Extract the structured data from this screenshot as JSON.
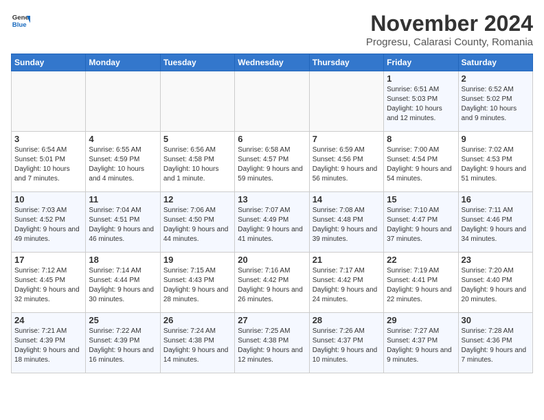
{
  "header": {
    "logo_general": "General",
    "logo_blue": "Blue",
    "month": "November 2024",
    "location": "Progresu, Calarasi County, Romania"
  },
  "days_of_week": [
    "Sunday",
    "Monday",
    "Tuesday",
    "Wednesday",
    "Thursday",
    "Friday",
    "Saturday"
  ],
  "weeks": [
    [
      {
        "day": "",
        "info": ""
      },
      {
        "day": "",
        "info": ""
      },
      {
        "day": "",
        "info": ""
      },
      {
        "day": "",
        "info": ""
      },
      {
        "day": "",
        "info": ""
      },
      {
        "day": "1",
        "info": "Sunrise: 6:51 AM\nSunset: 5:03 PM\nDaylight: 10 hours and 12 minutes."
      },
      {
        "day": "2",
        "info": "Sunrise: 6:52 AM\nSunset: 5:02 PM\nDaylight: 10 hours and 9 minutes."
      }
    ],
    [
      {
        "day": "3",
        "info": "Sunrise: 6:54 AM\nSunset: 5:01 PM\nDaylight: 10 hours and 7 minutes."
      },
      {
        "day": "4",
        "info": "Sunrise: 6:55 AM\nSunset: 4:59 PM\nDaylight: 10 hours and 4 minutes."
      },
      {
        "day": "5",
        "info": "Sunrise: 6:56 AM\nSunset: 4:58 PM\nDaylight: 10 hours and 1 minute."
      },
      {
        "day": "6",
        "info": "Sunrise: 6:58 AM\nSunset: 4:57 PM\nDaylight: 9 hours and 59 minutes."
      },
      {
        "day": "7",
        "info": "Sunrise: 6:59 AM\nSunset: 4:56 PM\nDaylight: 9 hours and 56 minutes."
      },
      {
        "day": "8",
        "info": "Sunrise: 7:00 AM\nSunset: 4:54 PM\nDaylight: 9 hours and 54 minutes."
      },
      {
        "day": "9",
        "info": "Sunrise: 7:02 AM\nSunset: 4:53 PM\nDaylight: 9 hours and 51 minutes."
      }
    ],
    [
      {
        "day": "10",
        "info": "Sunrise: 7:03 AM\nSunset: 4:52 PM\nDaylight: 9 hours and 49 minutes."
      },
      {
        "day": "11",
        "info": "Sunrise: 7:04 AM\nSunset: 4:51 PM\nDaylight: 9 hours and 46 minutes."
      },
      {
        "day": "12",
        "info": "Sunrise: 7:06 AM\nSunset: 4:50 PM\nDaylight: 9 hours and 44 minutes."
      },
      {
        "day": "13",
        "info": "Sunrise: 7:07 AM\nSunset: 4:49 PM\nDaylight: 9 hours and 41 minutes."
      },
      {
        "day": "14",
        "info": "Sunrise: 7:08 AM\nSunset: 4:48 PM\nDaylight: 9 hours and 39 minutes."
      },
      {
        "day": "15",
        "info": "Sunrise: 7:10 AM\nSunset: 4:47 PM\nDaylight: 9 hours and 37 minutes."
      },
      {
        "day": "16",
        "info": "Sunrise: 7:11 AM\nSunset: 4:46 PM\nDaylight: 9 hours and 34 minutes."
      }
    ],
    [
      {
        "day": "17",
        "info": "Sunrise: 7:12 AM\nSunset: 4:45 PM\nDaylight: 9 hours and 32 minutes."
      },
      {
        "day": "18",
        "info": "Sunrise: 7:14 AM\nSunset: 4:44 PM\nDaylight: 9 hours and 30 minutes."
      },
      {
        "day": "19",
        "info": "Sunrise: 7:15 AM\nSunset: 4:43 PM\nDaylight: 9 hours and 28 minutes."
      },
      {
        "day": "20",
        "info": "Sunrise: 7:16 AM\nSunset: 4:42 PM\nDaylight: 9 hours and 26 minutes."
      },
      {
        "day": "21",
        "info": "Sunrise: 7:17 AM\nSunset: 4:42 PM\nDaylight: 9 hours and 24 minutes."
      },
      {
        "day": "22",
        "info": "Sunrise: 7:19 AM\nSunset: 4:41 PM\nDaylight: 9 hours and 22 minutes."
      },
      {
        "day": "23",
        "info": "Sunrise: 7:20 AM\nSunset: 4:40 PM\nDaylight: 9 hours and 20 minutes."
      }
    ],
    [
      {
        "day": "24",
        "info": "Sunrise: 7:21 AM\nSunset: 4:39 PM\nDaylight: 9 hours and 18 minutes."
      },
      {
        "day": "25",
        "info": "Sunrise: 7:22 AM\nSunset: 4:39 PM\nDaylight: 9 hours and 16 minutes."
      },
      {
        "day": "26",
        "info": "Sunrise: 7:24 AM\nSunset: 4:38 PM\nDaylight: 9 hours and 14 minutes."
      },
      {
        "day": "27",
        "info": "Sunrise: 7:25 AM\nSunset: 4:38 PM\nDaylight: 9 hours and 12 minutes."
      },
      {
        "day": "28",
        "info": "Sunrise: 7:26 AM\nSunset: 4:37 PM\nDaylight: 9 hours and 10 minutes."
      },
      {
        "day": "29",
        "info": "Sunrise: 7:27 AM\nSunset: 4:37 PM\nDaylight: 9 hours and 9 minutes."
      },
      {
        "day": "30",
        "info": "Sunrise: 7:28 AM\nSunset: 4:36 PM\nDaylight: 9 hours and 7 minutes."
      }
    ]
  ]
}
